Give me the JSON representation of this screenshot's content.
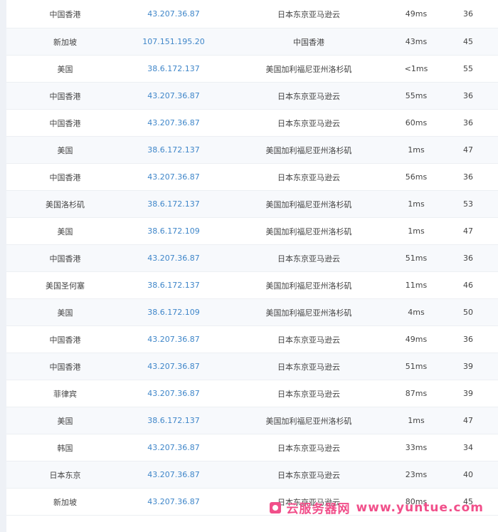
{
  "rows": [
    {
      "location": "中国香港",
      "ip": "43.207.36.87",
      "isp": "日本东京亚马逊云",
      "response_time": "49ms",
      "ttl": "36"
    },
    {
      "location": "新加坡",
      "ip": "107.151.195.20",
      "isp": "中国香港",
      "response_time": "43ms",
      "ttl": "45"
    },
    {
      "location": "美国",
      "ip": "38.6.172.137",
      "isp": "美国加利福尼亚州洛杉矶",
      "response_time": "<1ms",
      "ttl": "55"
    },
    {
      "location": "中国香港",
      "ip": "43.207.36.87",
      "isp": "日本东京亚马逊云",
      "response_time": "55ms",
      "ttl": "36"
    },
    {
      "location": "中国香港",
      "ip": "43.207.36.87",
      "isp": "日本东京亚马逊云",
      "response_time": "60ms",
      "ttl": "36"
    },
    {
      "location": "美国",
      "ip": "38.6.172.137",
      "isp": "美国加利福尼亚州洛杉矶",
      "response_time": "1ms",
      "ttl": "47"
    },
    {
      "location": "中国香港",
      "ip": "43.207.36.87",
      "isp": "日本东京亚马逊云",
      "response_time": "56ms",
      "ttl": "36"
    },
    {
      "location": "美国洛杉矶",
      "ip": "38.6.172.137",
      "isp": "美国加利福尼亚州洛杉矶",
      "response_time": "1ms",
      "ttl": "53"
    },
    {
      "location": "美国",
      "ip": "38.6.172.109",
      "isp": "美国加利福尼亚州洛杉矶",
      "response_time": "1ms",
      "ttl": "47"
    },
    {
      "location": "中国香港",
      "ip": "43.207.36.87",
      "isp": "日本东京亚马逊云",
      "response_time": "51ms",
      "ttl": "36"
    },
    {
      "location": "美国圣何塞",
      "ip": "38.6.172.137",
      "isp": "美国加利福尼亚州洛杉矶",
      "response_time": "11ms",
      "ttl": "46"
    },
    {
      "location": "美国",
      "ip": "38.6.172.109",
      "isp": "美国加利福尼亚州洛杉矶",
      "response_time": "4ms",
      "ttl": "50"
    },
    {
      "location": "中国香港",
      "ip": "43.207.36.87",
      "isp": "日本东京亚马逊云",
      "response_time": "49ms",
      "ttl": "36"
    },
    {
      "location": "中国香港",
      "ip": "43.207.36.87",
      "isp": "日本东京亚马逊云",
      "response_time": "51ms",
      "ttl": "39"
    },
    {
      "location": "菲律宾",
      "ip": "43.207.36.87",
      "isp": "日本东京亚马逊云",
      "response_time": "87ms",
      "ttl": "39"
    },
    {
      "location": "美国",
      "ip": "38.6.172.137",
      "isp": "美国加利福尼亚州洛杉矶",
      "response_time": "1ms",
      "ttl": "47"
    },
    {
      "location": "韩国",
      "ip": "43.207.36.87",
      "isp": "日本东京亚马逊云",
      "response_time": "33ms",
      "ttl": "34"
    },
    {
      "location": "日本东京",
      "ip": "43.207.36.87",
      "isp": "日本东京亚马逊云",
      "response_time": "23ms",
      "ttl": "40"
    },
    {
      "location": "新加坡",
      "ip": "43.207.36.87",
      "isp": "日本东京亚马逊云",
      "response_time": "80ms",
      "ttl": "45"
    }
  ],
  "watermark": {
    "brand": "云服务器网",
    "url": "www.yuntue.com"
  },
  "colors": {
    "link": "#3f86c9",
    "row_alt": "#f7f9fc",
    "border": "#eceff3",
    "watermark": "#f14f8a"
  }
}
